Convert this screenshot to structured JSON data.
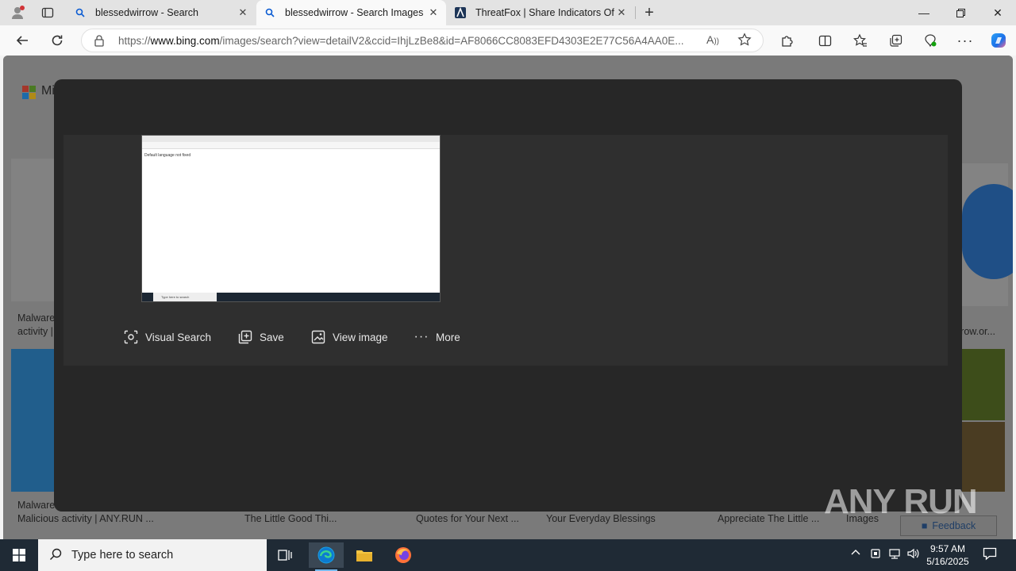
{
  "browser": {
    "tabs": [
      {
        "label": "blessedwirrow - Search",
        "active": false
      },
      {
        "label": "blessedwirrow - Search Images",
        "active": true
      },
      {
        "label": "ThreatFox | Share Indicators Of Co",
        "active": false
      }
    ],
    "url_prefix": "https://",
    "url_domain": "www.bing.com",
    "url_rest": "/images/search?view=detailV2&ccid=IhjLzBe8&id=AF8066CC8083EFD4303E2E77C56A4AA0E..."
  },
  "background": {
    "logo_text": "Mi",
    "result_labels": [
      {
        "text": "Malware"
      },
      {
        "text": "activity |"
      },
      {
        "text": "Malware"
      },
      {
        "text": "Malicious activity | ANY.RUN ..."
      },
      {
        "text": "The Little Good Thi..."
      },
      {
        "text": "Quotes for Your Next ..."
      },
      {
        "text": "Your Everyday Blessings"
      },
      {
        "text": "Appreciate The Little ..."
      },
      {
        "text": "Images"
      },
      {
        "text": "rrow.or..."
      }
    ],
    "feedback": "Feedback"
  },
  "viewer": {
    "inner_page_text": "Default language not fixed",
    "inner_taskbar_text": "Type here to search",
    "actions": [
      {
        "label": "Visual Search",
        "icon": "visual-search-icon"
      },
      {
        "label": "Save",
        "icon": "save-icon"
      },
      {
        "label": "View image",
        "icon": "view-image-icon"
      },
      {
        "label": "More",
        "icon": "more-icon"
      }
    ]
  },
  "watermark": "ANY RUN",
  "taskbar": {
    "search_placeholder": "Type here to search",
    "time": "9:57 AM",
    "date": "5/16/2025"
  },
  "colors": {
    "accent": "#0078d4",
    "modal": "#272727",
    "taskbar": "#1f2a35"
  }
}
